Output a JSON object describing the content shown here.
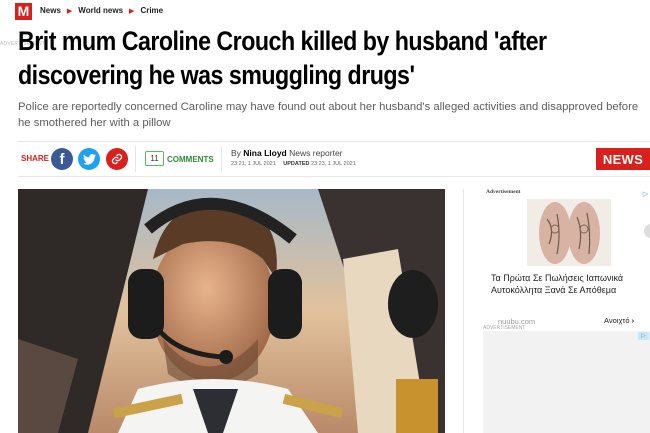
{
  "site": {
    "logo_letter": "M"
  },
  "breadcrumb": [
    "News",
    "World news",
    "Crime"
  ],
  "overline": "ADVERTISEMENT",
  "headline": "Brit mum Caroline Crouch killed by husband 'after discovering he was smuggling drugs'",
  "standfirst": "Police are reportedly concerned Caroline may have found out about her husband's alleged activities and disapproved before he smothered her with a pillow",
  "share": {
    "label": "SHARE",
    "facebook_glyph": "f",
    "twitter_icon": "twitter-icon",
    "link_icon": "link-icon"
  },
  "comments": {
    "count": "11",
    "label": "COMMENTS"
  },
  "byline": {
    "prefix": "By",
    "author": "Nina Lloyd",
    "role": "News reporter",
    "published": "23:21, 1 JUL 2021",
    "updated_label": "UPDATED",
    "updated": "23:23, 1 JUL 2021"
  },
  "section_badge": "NEWS",
  "advert": {
    "label": "Advertisement",
    "text": "Τα Πρώτα Σε Πωλήσεις Ιαπωνικά Αυτοκόλλητα Ξανά Σε Απόθεμα",
    "source": "nuubu.com",
    "cta": "Ανοιχτό",
    "bottom_label": "ADVERTISEMENT"
  },
  "colors": {
    "brand_red": "#d8201d",
    "facebook": "#3b5998",
    "twitter": "#1da1f2",
    "comments_green": "#2e8b3a"
  }
}
